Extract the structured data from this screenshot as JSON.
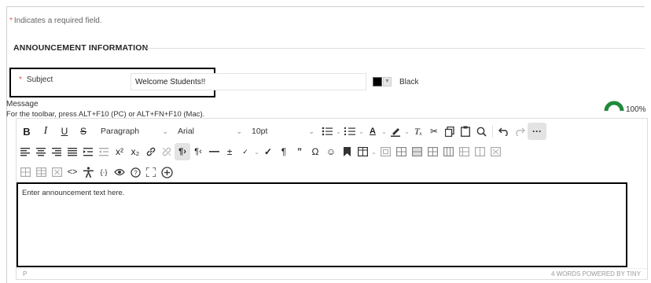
{
  "form": {
    "required_star": "*",
    "required_note": "Indicates a required field.",
    "section_title": "ANNOUNCEMENT INFORMATION",
    "subject_label": "Subject",
    "subject_value": "Welcome Students!!",
    "subject_color_name": "Black",
    "subject_color_hex": "#000000",
    "message_label": "Message",
    "message_hint": "For the toolbar, press ALT+F10 (PC) or ALT+FN+F10 (Mac).",
    "accessibility_score": "100%"
  },
  "toolbar": {
    "paragraph_select": "Paragraph",
    "font_select": "Arial",
    "size_select": "10pt",
    "bold": "B",
    "italic": "I",
    "underline": "U",
    "strike": "S",
    "more": "···"
  },
  "editor": {
    "content": "Enter announcement text here.",
    "status_path": "P",
    "word_count": "4 WORDS",
    "powered_by": "POWERED BY TINY"
  },
  "colors": {
    "required": "#d9534f",
    "gauge": "#1f8a3a"
  }
}
